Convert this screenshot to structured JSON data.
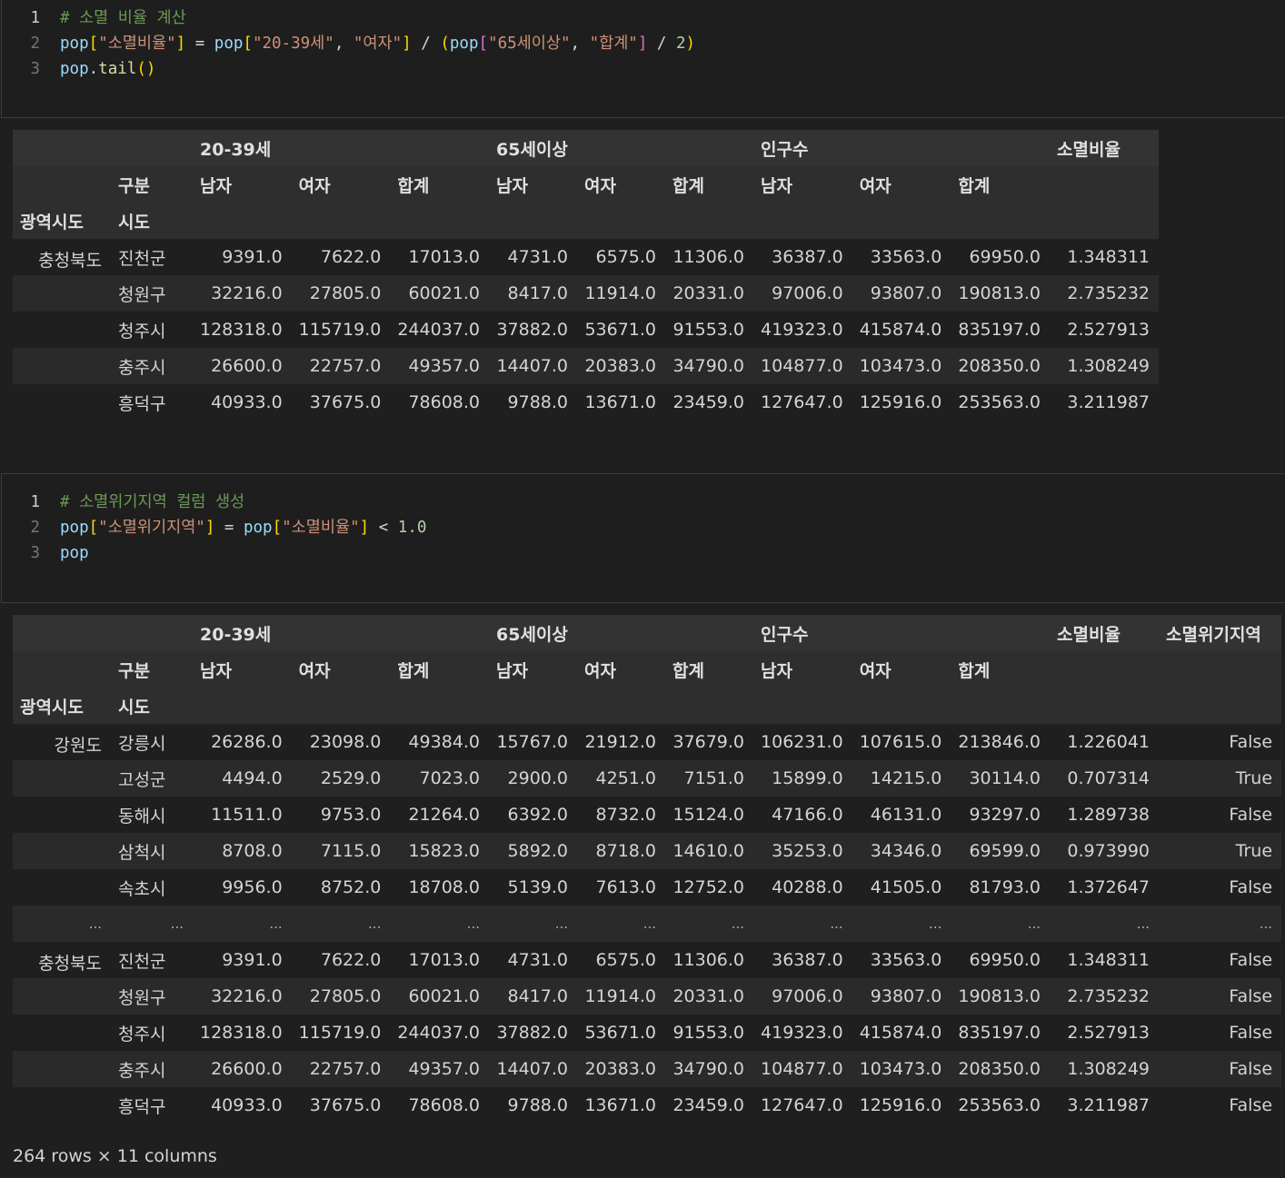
{
  "cell1": {
    "lines": [
      {
        "n": "1",
        "tokens": [
          [
            "comment",
            "# 소멸 비율 계산"
          ]
        ]
      },
      {
        "n": "2",
        "tokens": [
          [
            "var",
            "pop"
          ],
          [
            "b1",
            "["
          ],
          [
            "str",
            "\"소멸비율\""
          ],
          [
            "b1",
            "]"
          ],
          [
            "op",
            " = "
          ],
          [
            "var",
            "pop"
          ],
          [
            "b1",
            "["
          ],
          [
            "str",
            "\"20-39세\""
          ],
          [
            "op",
            ", "
          ],
          [
            "str",
            "\"여자\""
          ],
          [
            "b1",
            "]"
          ],
          [
            "op",
            " / "
          ],
          [
            "b1",
            "("
          ],
          [
            "var",
            "pop"
          ],
          [
            "b2",
            "["
          ],
          [
            "str",
            "\"65세이상\""
          ],
          [
            "op",
            ", "
          ],
          [
            "str",
            "\"합계\""
          ],
          [
            "b2",
            "]"
          ],
          [
            "op",
            " / "
          ],
          [
            "num",
            "2"
          ],
          [
            "b1",
            ")"
          ]
        ]
      },
      {
        "n": "3",
        "tokens": [
          [
            "var",
            "pop"
          ],
          [
            "op",
            "."
          ],
          [
            "fn",
            "tail"
          ],
          [
            "b1",
            "()"
          ]
        ]
      }
    ]
  },
  "out1": {
    "header_top": [
      "",
      "",
      "20-39세",
      "",
      "",
      "65세이상",
      "",
      "",
      "인구수",
      "",
      "",
      "소멸비율"
    ],
    "header_mid": [
      "",
      "구분",
      "남자",
      "여자",
      "합계",
      "남자",
      "여자",
      "합계",
      "남자",
      "여자",
      "합계",
      ""
    ],
    "index_names": [
      "광역시도",
      "시도"
    ],
    "rows": [
      [
        "충청북도",
        "진천군",
        "9391.0",
        "7622.0",
        "17013.0",
        "4731.0",
        "6575.0",
        "11306.0",
        "36387.0",
        "33563.0",
        "69950.0",
        "1.348311"
      ],
      [
        "",
        "청원구",
        "32216.0",
        "27805.0",
        "60021.0",
        "8417.0",
        "11914.0",
        "20331.0",
        "97006.0",
        "93807.0",
        "190813.0",
        "2.735232"
      ],
      [
        "",
        "청주시",
        "128318.0",
        "115719.0",
        "244037.0",
        "37882.0",
        "53671.0",
        "91553.0",
        "419323.0",
        "415874.0",
        "835197.0",
        "2.527913"
      ],
      [
        "",
        "충주시",
        "26600.0",
        "22757.0",
        "49357.0",
        "14407.0",
        "20383.0",
        "34790.0",
        "104877.0",
        "103473.0",
        "208350.0",
        "1.308249"
      ],
      [
        "",
        "흥덕구",
        "40933.0",
        "37675.0",
        "78608.0",
        "9788.0",
        "13671.0",
        "23459.0",
        "127647.0",
        "125916.0",
        "253563.0",
        "3.211987"
      ]
    ]
  },
  "cell2": {
    "lines": [
      {
        "n": "1",
        "tokens": [
          [
            "comment",
            "# 소멸위기지역 컬럼 생성"
          ]
        ]
      },
      {
        "n": "2",
        "tokens": [
          [
            "var",
            "pop"
          ],
          [
            "b1",
            "["
          ],
          [
            "str",
            "\"소멸위기지역\""
          ],
          [
            "b1",
            "]"
          ],
          [
            "op",
            " = "
          ],
          [
            "var",
            "pop"
          ],
          [
            "b1",
            "["
          ],
          [
            "str",
            "\"소멸비율\""
          ],
          [
            "b1",
            "]"
          ],
          [
            "op",
            " < "
          ],
          [
            "num",
            "1.0"
          ]
        ]
      },
      {
        "n": "3",
        "tokens": [
          [
            "var",
            "pop"
          ]
        ]
      }
    ]
  },
  "out2": {
    "header_top": [
      "",
      "",
      "20-39세",
      "",
      "",
      "65세이상",
      "",
      "",
      "인구수",
      "",
      "",
      "소멸비율",
      "소멸위기지역"
    ],
    "header_mid": [
      "",
      "구분",
      "남자",
      "여자",
      "합계",
      "남자",
      "여자",
      "합계",
      "남자",
      "여자",
      "합계",
      "",
      ""
    ],
    "index_names": [
      "광역시도",
      "시도"
    ],
    "rows_top": [
      [
        "강원도",
        "강릉시",
        "26286.0",
        "23098.0",
        "49384.0",
        "15767.0",
        "21912.0",
        "37679.0",
        "106231.0",
        "107615.0",
        "213846.0",
        "1.226041",
        "False"
      ],
      [
        "",
        "고성군",
        "4494.0",
        "2529.0",
        "7023.0",
        "2900.0",
        "4251.0",
        "7151.0",
        "15899.0",
        "14215.0",
        "30114.0",
        "0.707314",
        "True"
      ],
      [
        "",
        "동해시",
        "11511.0",
        "9753.0",
        "21264.0",
        "6392.0",
        "8732.0",
        "15124.0",
        "47166.0",
        "46131.0",
        "93297.0",
        "1.289738",
        "False"
      ],
      [
        "",
        "삼척시",
        "8708.0",
        "7115.0",
        "15823.0",
        "5892.0",
        "8718.0",
        "14610.0",
        "35253.0",
        "34346.0",
        "69599.0",
        "0.973990",
        "True"
      ],
      [
        "",
        "속초시",
        "9956.0",
        "8752.0",
        "18708.0",
        "5139.0",
        "7613.0",
        "12752.0",
        "40288.0",
        "41505.0",
        "81793.0",
        "1.372647",
        "False"
      ]
    ],
    "ellipsis": [
      "...",
      "...",
      "...",
      "...",
      "...",
      "...",
      "...",
      "...",
      "...",
      "...",
      "...",
      "...",
      "..."
    ],
    "rows_bottom": [
      [
        "충청북도",
        "진천군",
        "9391.0",
        "7622.0",
        "17013.0",
        "4731.0",
        "6575.0",
        "11306.0",
        "36387.0",
        "33563.0",
        "69950.0",
        "1.348311",
        "False"
      ],
      [
        "",
        "청원구",
        "32216.0",
        "27805.0",
        "60021.0",
        "8417.0",
        "11914.0",
        "20331.0",
        "97006.0",
        "93807.0",
        "190813.0",
        "2.735232",
        "False"
      ],
      [
        "",
        "청주시",
        "128318.0",
        "115719.0",
        "244037.0",
        "37882.0",
        "53671.0",
        "91553.0",
        "419323.0",
        "415874.0",
        "835197.0",
        "2.527913",
        "False"
      ],
      [
        "",
        "충주시",
        "26600.0",
        "22757.0",
        "49357.0",
        "14407.0",
        "20383.0",
        "34790.0",
        "104877.0",
        "103473.0",
        "208350.0",
        "1.308249",
        "False"
      ],
      [
        "",
        "흥덕구",
        "40933.0",
        "37675.0",
        "78608.0",
        "9788.0",
        "13671.0",
        "23459.0",
        "127647.0",
        "125916.0",
        "253563.0",
        "3.211987",
        "False"
      ]
    ],
    "footer": "264 rows × 11 columns"
  }
}
